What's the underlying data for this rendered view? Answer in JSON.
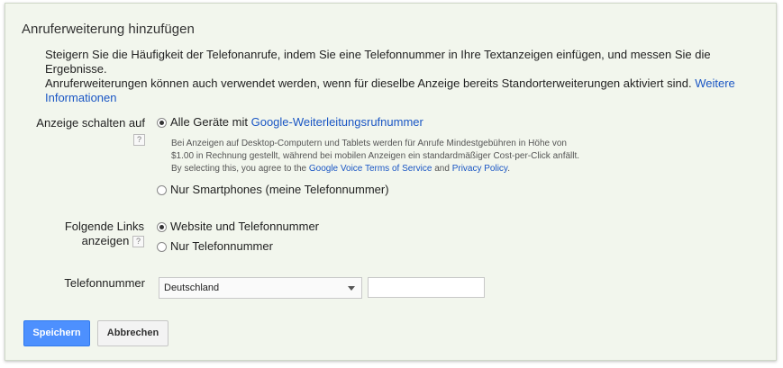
{
  "dialog": {
    "title": "Anruferweiterung hinzufügen",
    "intro_line1": "Steigern Sie die Häufigkeit der Telefonanrufe, indem Sie eine Telefonnummer in Ihre Textanzeigen einfügen, und messen Sie die Ergebnisse.",
    "intro_line2": "Anruferweiterungen können auch verwendet werden, wenn für dieselbe Anzeige bereits Standorterweiterungen aktiviert sind.",
    "intro_link": "Weitere Informationen"
  },
  "show_ads_on": {
    "label": "Anzeige schalten auf",
    "help": "?",
    "option_all_prefix": "Alle Geräte mit",
    "option_all_link": "Google-Weiterleitungsrufnummer",
    "note_line1": "Bei Anzeigen auf Desktop-Computern und Tablets werden für Anrufe Mindestgebühren in Höhe von",
    "note_line2": "$1.00 in Rechnung gestellt, während bei mobilen Anzeigen ein standardmäßiger Cost-per-Click anfällt.",
    "note_line3_prefix": "By selecting this, you agree to the",
    "note_link_tos": "Google Voice Terms of Service",
    "note_and": "and",
    "note_link_privacy": "Privacy Policy",
    "note_period": ".",
    "option_smartphones": "Nur Smartphones (meine Telefonnummer)",
    "selected": "all_devices"
  },
  "links_shown": {
    "label_line1": "Folgende Links",
    "label_line2": "anzeigen",
    "help": "?",
    "option_website_phone": "Website und Telefonnummer",
    "option_phone_only": "Nur Telefonnummer",
    "selected": "website_phone"
  },
  "phone": {
    "label": "Telefonnummer",
    "country_selected": "Deutschland",
    "number_value": ""
  },
  "actions": {
    "save": "Speichern",
    "cancel": "Abbrechen"
  },
  "colors": {
    "panel_bg": "#f2f6ed",
    "link": "#1a56c4",
    "primary_button": "#4d90fe"
  }
}
